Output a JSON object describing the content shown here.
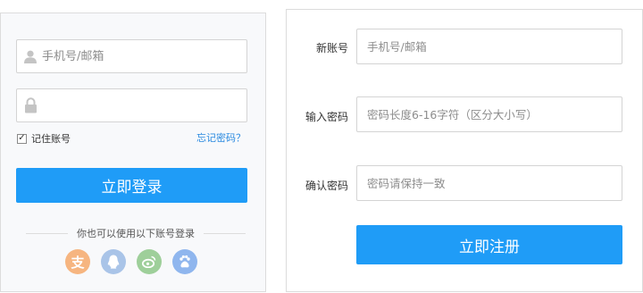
{
  "login": {
    "account_placeholder": "手机号/邮箱",
    "password_placeholder": "",
    "remember_label": "记住账号",
    "remember_checked": true,
    "forgot_label": "忘记密码？",
    "submit_label": "立即登录",
    "alt_login_text": "你也可以使用以下账号登录",
    "social": [
      {
        "name": "alipay",
        "glyph": "支",
        "color": "#f6b580"
      },
      {
        "name": "qq",
        "glyph": "",
        "color": "#a9c4e8"
      },
      {
        "name": "weibo",
        "glyph": "",
        "color": "#9ecf9a"
      },
      {
        "name": "baidu",
        "glyph": "",
        "color": "#8fb6ee"
      }
    ],
    "colors": {
      "primary": "#1f9cf7",
      "link": "#2a8ae0"
    }
  },
  "register": {
    "fields": [
      {
        "label": "新账号",
        "placeholder": "手机号/邮箱"
      },
      {
        "label": "输入密码",
        "placeholder": "密码长度6-16字符（区分大小写）"
      },
      {
        "label": "确认密码",
        "placeholder": "密码请保持一致"
      }
    ],
    "submit_label": "立即注册"
  }
}
